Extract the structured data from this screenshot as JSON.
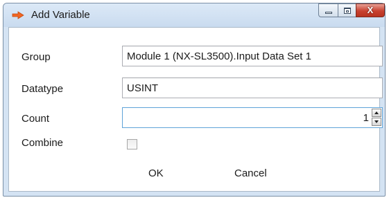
{
  "window": {
    "title": "Add Variable",
    "controls": {
      "minimize_icon": "minimize-icon",
      "maximize_icon": "maximize-icon",
      "close_glyph": "X"
    },
    "app_icon": "arrow-icon",
    "accent": "#f26522"
  },
  "form": {
    "group": {
      "label": "Group",
      "value": "Module 1 (NX-SL3500).Input Data Set 1"
    },
    "datatype": {
      "label": "Datatype",
      "value": "USINT"
    },
    "count": {
      "label": "Count",
      "value": "1"
    },
    "combine": {
      "label": "Combine",
      "checked": false
    }
  },
  "buttons": {
    "ok": "OK",
    "cancel": "Cancel"
  }
}
